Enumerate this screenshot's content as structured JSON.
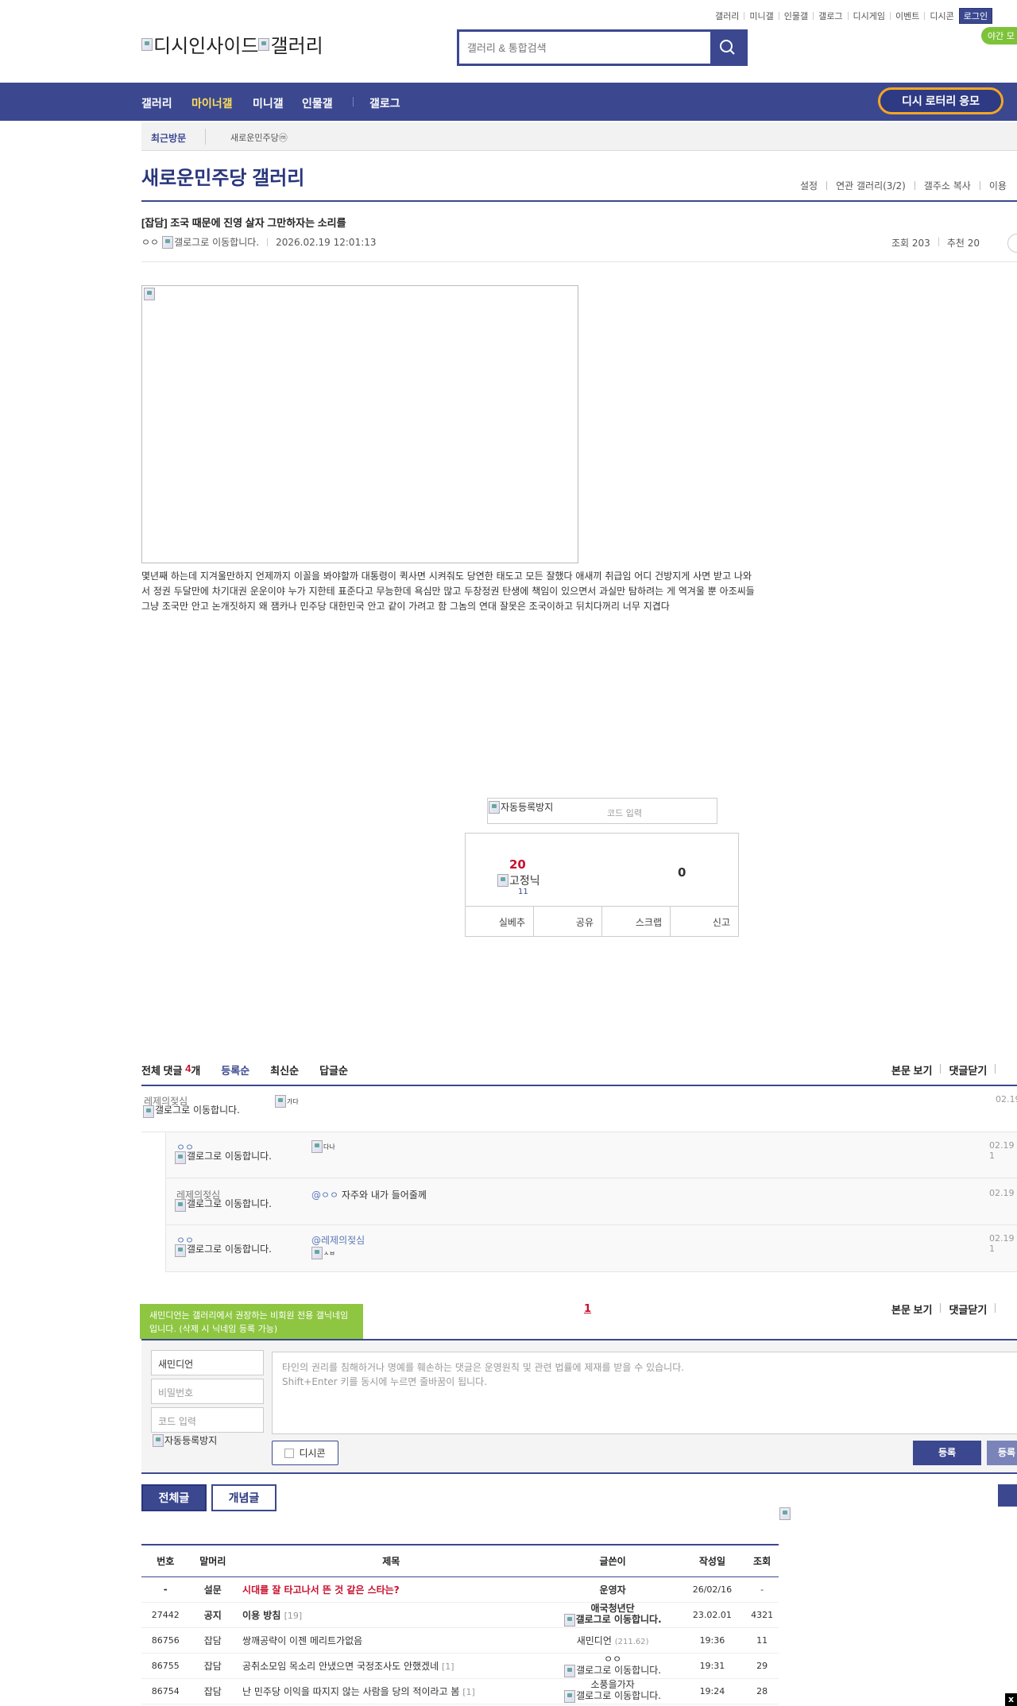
{
  "util": {
    "links": [
      "갤러리",
      "미니갤",
      "인물갤",
      "갤로그",
      "디시게임",
      "이벤트",
      "디시콘"
    ],
    "login": "로그인",
    "night": "야간 모"
  },
  "logo": {
    "alt1": "디시인사이드",
    "alt2": "갤러리"
  },
  "search": {
    "placeholder": "갤러리 & 통합검색"
  },
  "nav": {
    "items": [
      "갤러리",
      "마이너갤",
      "미니갤",
      "인물갤",
      "갤로그"
    ],
    "lottery": "디시 로터리 응모"
  },
  "recent": {
    "label": "최근방문",
    "gallery": "새로운민주당ⓜ"
  },
  "gallery": {
    "title": "새로운민주당 갤러리",
    "tools": [
      "설정",
      "연관 갤러리(3/2)",
      "갤주소 복사",
      "이용"
    ]
  },
  "post": {
    "title": "[잡담] 조국 때문에 진영 살자 그만하자는 소리를",
    "author": "ㅇㅇ",
    "author_gallog_alt": "갤로그로 이동합니다.",
    "date": "2026.02.19 12:01:13",
    "views": "조회 203",
    "recommend": "추천 20",
    "body_lines": [
      "몇년째 하는데 지겨울만하지 언제까지 이꼴을 봐야할까 대통령이 퀵사면 시켜줘도 당연한 태도고 모든 잘했다 애새끼 취급임 어디 건방지게 사면 받고 나와",
      "서 정권 두달만에 차기대권 운운이야 누가 지한테 표준다고 무능한데 욕심만 많고 두창정권 탄생에 책임이 있으면서 과실만 탐하려는 게 역겨울 뿐 아조씨들",
      "그냥 조국만 안고 논개짓하지 왜 잼카나 민주당 대한민국 안고 같이 가려고 함 그놈의 연대 잘못은 조국이하고 뒤치다꺼리 너무 지겹다"
    ]
  },
  "captcha": {
    "alt": "자동등록방지",
    "placeholder": "코드 입력"
  },
  "vote": {
    "up": "20",
    "fixed_alt": "고정닉",
    "fixed_count": "11",
    "down": "0",
    "buttons": [
      "실베추",
      "공유",
      "스크랩",
      "신고"
    ]
  },
  "comments": {
    "label": "전체 댓글",
    "count": "4",
    "unit": "개",
    "sorts": [
      "등록순",
      "최신순",
      "답글순"
    ],
    "right": [
      "본문 보기",
      "댓글닫기"
    ],
    "items": [
      {
        "nick": "레제의젖심",
        "gallog": "갤로그로 이동합니다.",
        "text_alt": "가다",
        "date": "02.19"
      },
      {
        "nick": "ㅇㅇ",
        "gallog": "갤로그로 이동합니다.",
        "text_alt": "다나",
        "date": "02.19 1"
      },
      {
        "nick": "레제의젖심",
        "gallog": "갤로그로 이동합니다.",
        "mention": "@ㅇㅇ",
        "text": "자주와 내가 들어줄께",
        "date": "02.19"
      },
      {
        "nick": "ㅇㅇ",
        "gallog": "갤로그로 이동합니다.",
        "mention": "@레제의젖심",
        "text_alt": "ㅅㅂ",
        "date": "02.19 1"
      }
    ],
    "page": "1"
  },
  "write": {
    "tooltip": "새민디언는 갤러리에서 권장하는 비회원 전용 갤닉네임입니다. (삭제 시 닉네임 등록 가능)",
    "nick_value": "새민디언",
    "password_placeholder": "비밀번호",
    "code_placeholder": "코드 입력",
    "captcha_alt": "자동등록방지",
    "textarea_placeholder_1": "타인의 권리를 침해하거나 명예를 훼손하는 댓글은 운영원칙 및 관련 법률에 제재를 받을 수 있습니다.",
    "textarea_placeholder_2": "Shift+Enter 키를 동시에 누르면 줄바꿈이 됩니다.",
    "dccon": "디시콘",
    "submit": "등록",
    "submit2": "등록"
  },
  "list": {
    "tabs": [
      "전체글",
      "개념글"
    ],
    "headers": [
      "번호",
      "말머리",
      "제목",
      "글쓴이",
      "작성일",
      "조회"
    ],
    "rows": [
      {
        "no": "-",
        "head": "설문",
        "title": "시대를 잘 타고나서 뜬 것 같은 스타는?",
        "reply": "",
        "writer": "운영자",
        "writer_line2": "",
        "ip": "",
        "date": "26/02/16",
        "views": "-",
        "type": "survey"
      },
      {
        "no": "27442",
        "head": "공지",
        "title": "이용 방침",
        "reply": "[19]",
        "writer": "애국청년단",
        "writer_line2": "갤로그로 이동합니다.",
        "ip": "",
        "date": "23.02.01",
        "views": "4321",
        "type": "notice"
      },
      {
        "no": "86756",
        "head": "잡담",
        "title": "쌍깨공략이 이젠 메리트가없음",
        "reply": "",
        "writer": "새민디언",
        "writer_line2": "",
        "ip": "(211.62)",
        "date": "19:36",
        "views": "11",
        "type": "normal"
      },
      {
        "no": "86755",
        "head": "잡담",
        "title": "공취소모임 목소리 안냈으면 국정조사도 안했겠네",
        "reply": "[1]",
        "writer": "ㅇㅇ",
        "writer_line2": "갤로그로 이동합니다.",
        "ip": "",
        "date": "19:31",
        "views": "29",
        "type": "normal"
      },
      {
        "no": "86754",
        "head": "잡담",
        "title": "난 민주당 이익을 따지지 않는 사람을 당의 적이라고 봄",
        "reply": "[1]",
        "writer": "소풍을가자",
        "writer_line2": "갤로그로 이동합니다.",
        "ip": "",
        "date": "19:24",
        "views": "28",
        "type": "normal"
      }
    ]
  },
  "colors": {
    "primary": "#3b4890",
    "accent": "#ffde59",
    "red": "#c8102e",
    "green": "#8ec642",
    "orange": "#f5a623"
  }
}
